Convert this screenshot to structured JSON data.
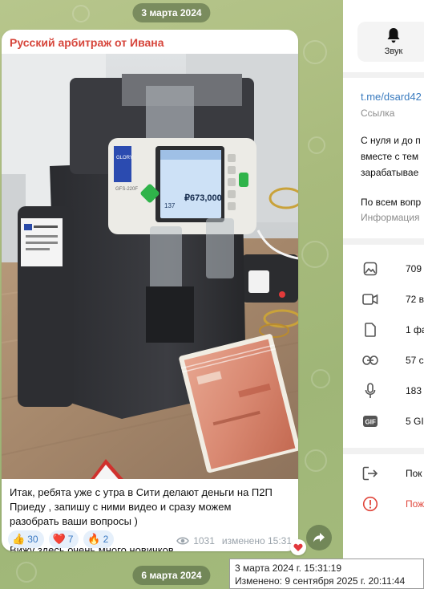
{
  "chat": {
    "date_top": "3 марта 2024",
    "date_bottom": "6 марта 2024",
    "message": {
      "sender": "Русский арбитраж от Ивана",
      "text": "Итак, ребята уже с утра в Сити делают деньги на П2П\nПриеду , запишу с ними видео и сразу можем\nразобрать ваши вопросы )\n\nВижу здесь очень много новичков.",
      "photo": {
        "counter_brand": "GLORY",
        "counter_model": "GFS-220F",
        "counter_count": "137",
        "counter_amount": "₽673,000"
      },
      "reactions": [
        {
          "emoji": "👍",
          "count": "30"
        },
        {
          "emoji": "❤️",
          "count": "7"
        },
        {
          "emoji": "🔥",
          "count": "2"
        }
      ],
      "views": "1031",
      "edited_time": "изменено 15:31"
    },
    "tooltip": {
      "line1": "3 марта 2024 г. 15:31:19",
      "line2": "Изменено: 9 сентября 2025 г. 20:11:44"
    }
  },
  "panel": {
    "sound_label": "Звук",
    "link": "t.me/dsard42",
    "link_caption": "Ссылка",
    "description_lines": [
      "С нуля и до п",
      "вместе с тем",
      "зарабатывае"
    ],
    "contact_line": "По всем вопр",
    "info_caption": "Информация",
    "media_rows": [
      {
        "icon": "photo-icon",
        "text": "709"
      },
      {
        "icon": "video-icon",
        "text": "72 в"
      },
      {
        "icon": "file-icon",
        "text": "1 фа"
      },
      {
        "icon": "link-icon",
        "text": "57 с"
      },
      {
        "icon": "voice-icon",
        "text": "183"
      },
      {
        "icon": "gif-icon",
        "text": "5 GI"
      }
    ],
    "actions": [
      {
        "icon": "leave-icon",
        "text": "Пок",
        "color": "#111111"
      },
      {
        "icon": "report-icon",
        "text": "Пож",
        "color": "#e0473c"
      }
    ]
  }
}
